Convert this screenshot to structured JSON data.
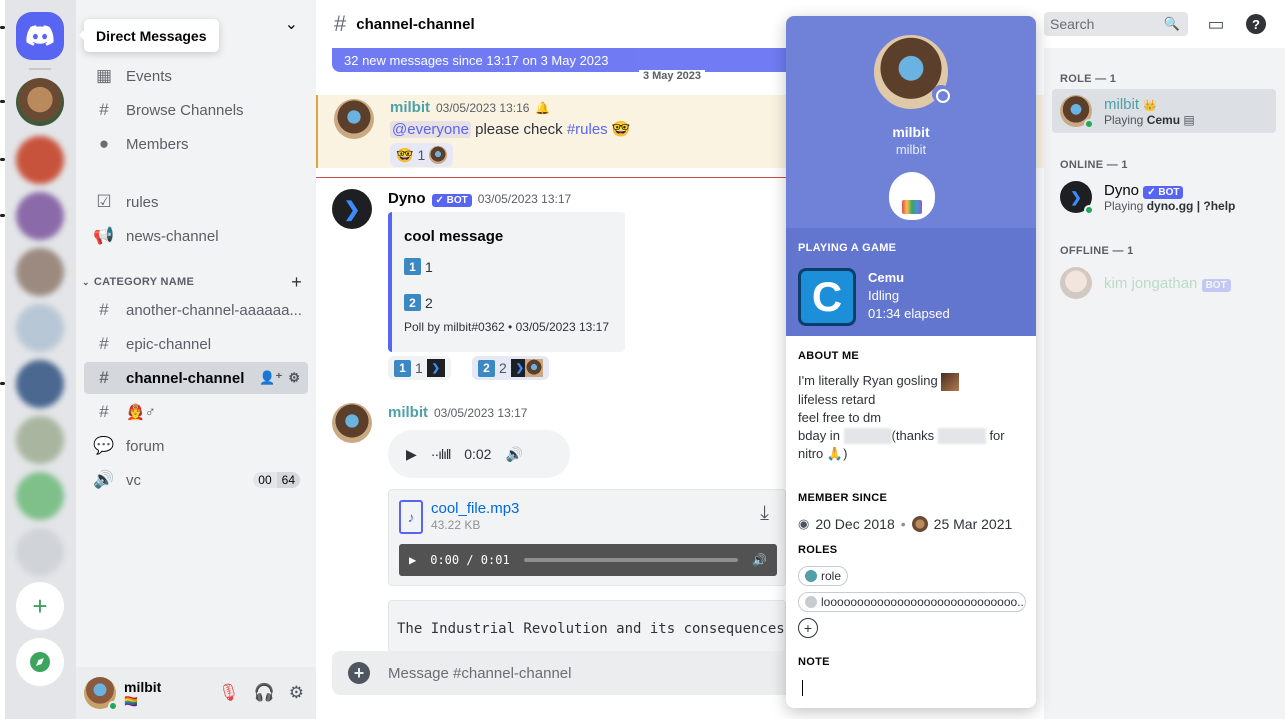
{
  "tooltip": "Direct Messages",
  "channel_sidebar": {
    "items": [
      {
        "label": "Events",
        "icon": "calendar-icon"
      },
      {
        "label": "Browse Channels",
        "icon": "browse-channels-icon"
      },
      {
        "label": "Members",
        "icon": "members-icon"
      },
      {
        "label": "rules",
        "icon": "rules-icon"
      },
      {
        "label": "news-channel",
        "icon": "megaphone-icon"
      }
    ],
    "category": "CATEGORY NAME",
    "channels": [
      {
        "label": "another-channel-aaaaaa...",
        "icon": "hash-icon"
      },
      {
        "label": "epic-channel",
        "icon": "hash-icon"
      },
      {
        "label": "channel-channel",
        "icon": "hash-icon",
        "selected": true
      },
      {
        "label": "🧑‍🚒♂",
        "icon": "hash-icon"
      },
      {
        "label": "forum",
        "icon": "forum-icon"
      },
      {
        "label": "vc",
        "icon": "speaker-icon",
        "voice_count": [
          "00",
          "64"
        ]
      }
    ]
  },
  "user_panel": {
    "name": "milbit",
    "status": "🏳️‍🌈"
  },
  "header": {
    "channel": "channel-channel",
    "search_placeholder": "Search"
  },
  "new_messages_bar": "32 new messages since 13:17 on 3 May 2023",
  "date_divider": "3 May 2023",
  "messages": {
    "m1": {
      "author": "milbit",
      "time": "03/05/2023 13:16",
      "mention": "@everyone",
      "text": " please check ",
      "channel_link": "#rules",
      "emoji": "🤓",
      "reaction_count": "1"
    },
    "m2": {
      "author": "Dyno",
      "bot": "✓ BOT",
      "time": "03/05/2023 13:17",
      "embed_title": "cool message",
      "option1_num": "1",
      "option1_count": "1",
      "option2_num": "2",
      "option2_count": "2",
      "footer": "Poll by milbit#0362 • 03/05/2023 13:17",
      "reaction1_count": "1",
      "reaction2_count": "2"
    },
    "m3": {
      "author": "milbit",
      "time": "03/05/2023 13:17",
      "voice_duration": "0:02",
      "file_name": "cool_file.mp3",
      "file_size": "43.22 KB",
      "player_time": "0:00 / 0:01",
      "code": "The Industrial Revolution and its consequences"
    }
  },
  "composer_placeholder": "Message #channel-channel",
  "members": {
    "groups": [
      {
        "title": "ROLE — 1"
      },
      {
        "title": "ONLINE — 1"
      },
      {
        "title": "OFFLINE — 1"
      }
    ],
    "list": [
      {
        "name": "milbit",
        "status_prefix": "Playing ",
        "status_bold": "Cemu",
        "crown": "👑"
      },
      {
        "name": "Dyno",
        "bot": "✓ BOT",
        "status_prefix": "Playing ",
        "status_bold": "dyno.gg | ?help"
      },
      {
        "name": "kim jongathan",
        "bot": "BOT"
      }
    ]
  },
  "profile": {
    "display_name": "milbit",
    "username": "milbit",
    "playing_header": "PLAYING A GAME",
    "game": {
      "name": "Cemu",
      "state": "Idling",
      "elapsed": "01:34 elapsed",
      "logo_letter": "C"
    },
    "about_header": "ABOUT ME",
    "about_lines": [
      "I'm literally Ryan gosling",
      "lifeless retard",
      "feel free to dm"
    ],
    "about_bday_a": "bday in",
    "about_bday_b": "(thanks",
    "about_bday_c": "for",
    "about_bday_d": "nitro 🙏)",
    "member_since_header": "MEMBER SINCE",
    "discord_since": "20 Dec 2018",
    "server_since": "25 Mar 2021",
    "roles_header": "ROLES",
    "roles": [
      {
        "name": "role",
        "color": "#4fa0a8"
      },
      {
        "name": "looooooooooooooooooooooooooooo...",
        "color": "#c7ccd1"
      }
    ],
    "note_header": "NOTE"
  },
  "colors": {
    "blurple": "#5865f2",
    "profile_banner": "#6f82d8",
    "role_teal": "#4fa0a8",
    "online": "#23a55a"
  }
}
